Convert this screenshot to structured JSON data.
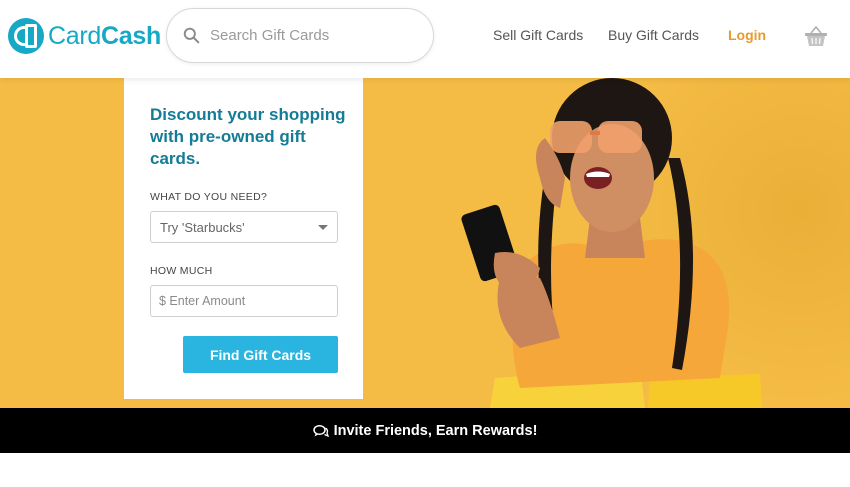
{
  "brand": {
    "name_part1": "Card",
    "name_part2": "Cash",
    "logo_icon": "cardcash-logo-icon",
    "color": "#17a8c6"
  },
  "search": {
    "placeholder": "Search Gift Cards",
    "icon": "search-icon"
  },
  "nav": {
    "sell": "Sell Gift Cards",
    "buy": "Buy Gift Cards",
    "login": "Login",
    "cart_icon": "shopping-basket-icon",
    "login_color": "#e89a2c"
  },
  "hero": {
    "background_color": "#f5bc45",
    "image": "woman-holding-phone-with-shopping-bags-photo",
    "panel": {
      "title": "Discount your shopping with pre-owned gift cards.",
      "need_label": "WHAT DO YOU NEED?",
      "need_placeholder": "Try 'Starbucks'",
      "amount_label": "HOW MUCH",
      "amount_placeholder": "$ Enter Amount",
      "button_label": "Find Gift Cards",
      "button_color": "#2ab5e0"
    }
  },
  "invite": {
    "text": "Invite Friends, Earn Rewards!",
    "icon": "chat-bubbles-icon"
  }
}
